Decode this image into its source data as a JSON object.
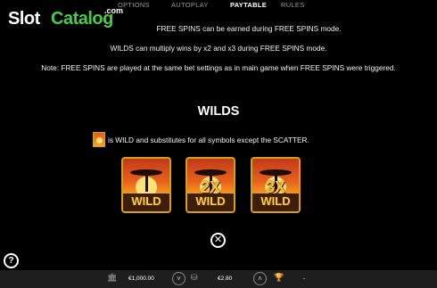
{
  "tabs": [
    {
      "label": "OPTIONS",
      "active": false
    },
    {
      "label": "AUTOPLAY",
      "active": false
    },
    {
      "label": "PAYTABLE",
      "active": true
    },
    {
      "label": "RULES",
      "active": false
    }
  ],
  "watermark": {
    "slot": "Slot",
    "catalog": "Catalog",
    "com": ".com"
  },
  "info_lines": [
    "FREE SPINS can be earned during FREE SPINS mode.",
    "WILDS can multiply wins by x2 and x3 during FREE SPINS mode.",
    "Note: FREE SPINS are played at the same bet settings as in main game when FREE SPINS were triggered."
  ],
  "wilds_section": {
    "title": "WILDS",
    "description": "is WILD and substitutes for all symbols except the SCATTER.",
    "tiles": [
      {
        "multiplier": "",
        "label": "WILD"
      },
      {
        "multiplier": "2X",
        "label": "WILD"
      },
      {
        "multiplier": "3X",
        "label": "WILD"
      }
    ]
  },
  "controls": {
    "close": "✕",
    "help": "?"
  },
  "bottom_bar": {
    "balance": "€1,000.00",
    "bet": "€2.80"
  },
  "colors": {
    "accent_green": "#4cc84c",
    "gold": "#d4a017"
  }
}
